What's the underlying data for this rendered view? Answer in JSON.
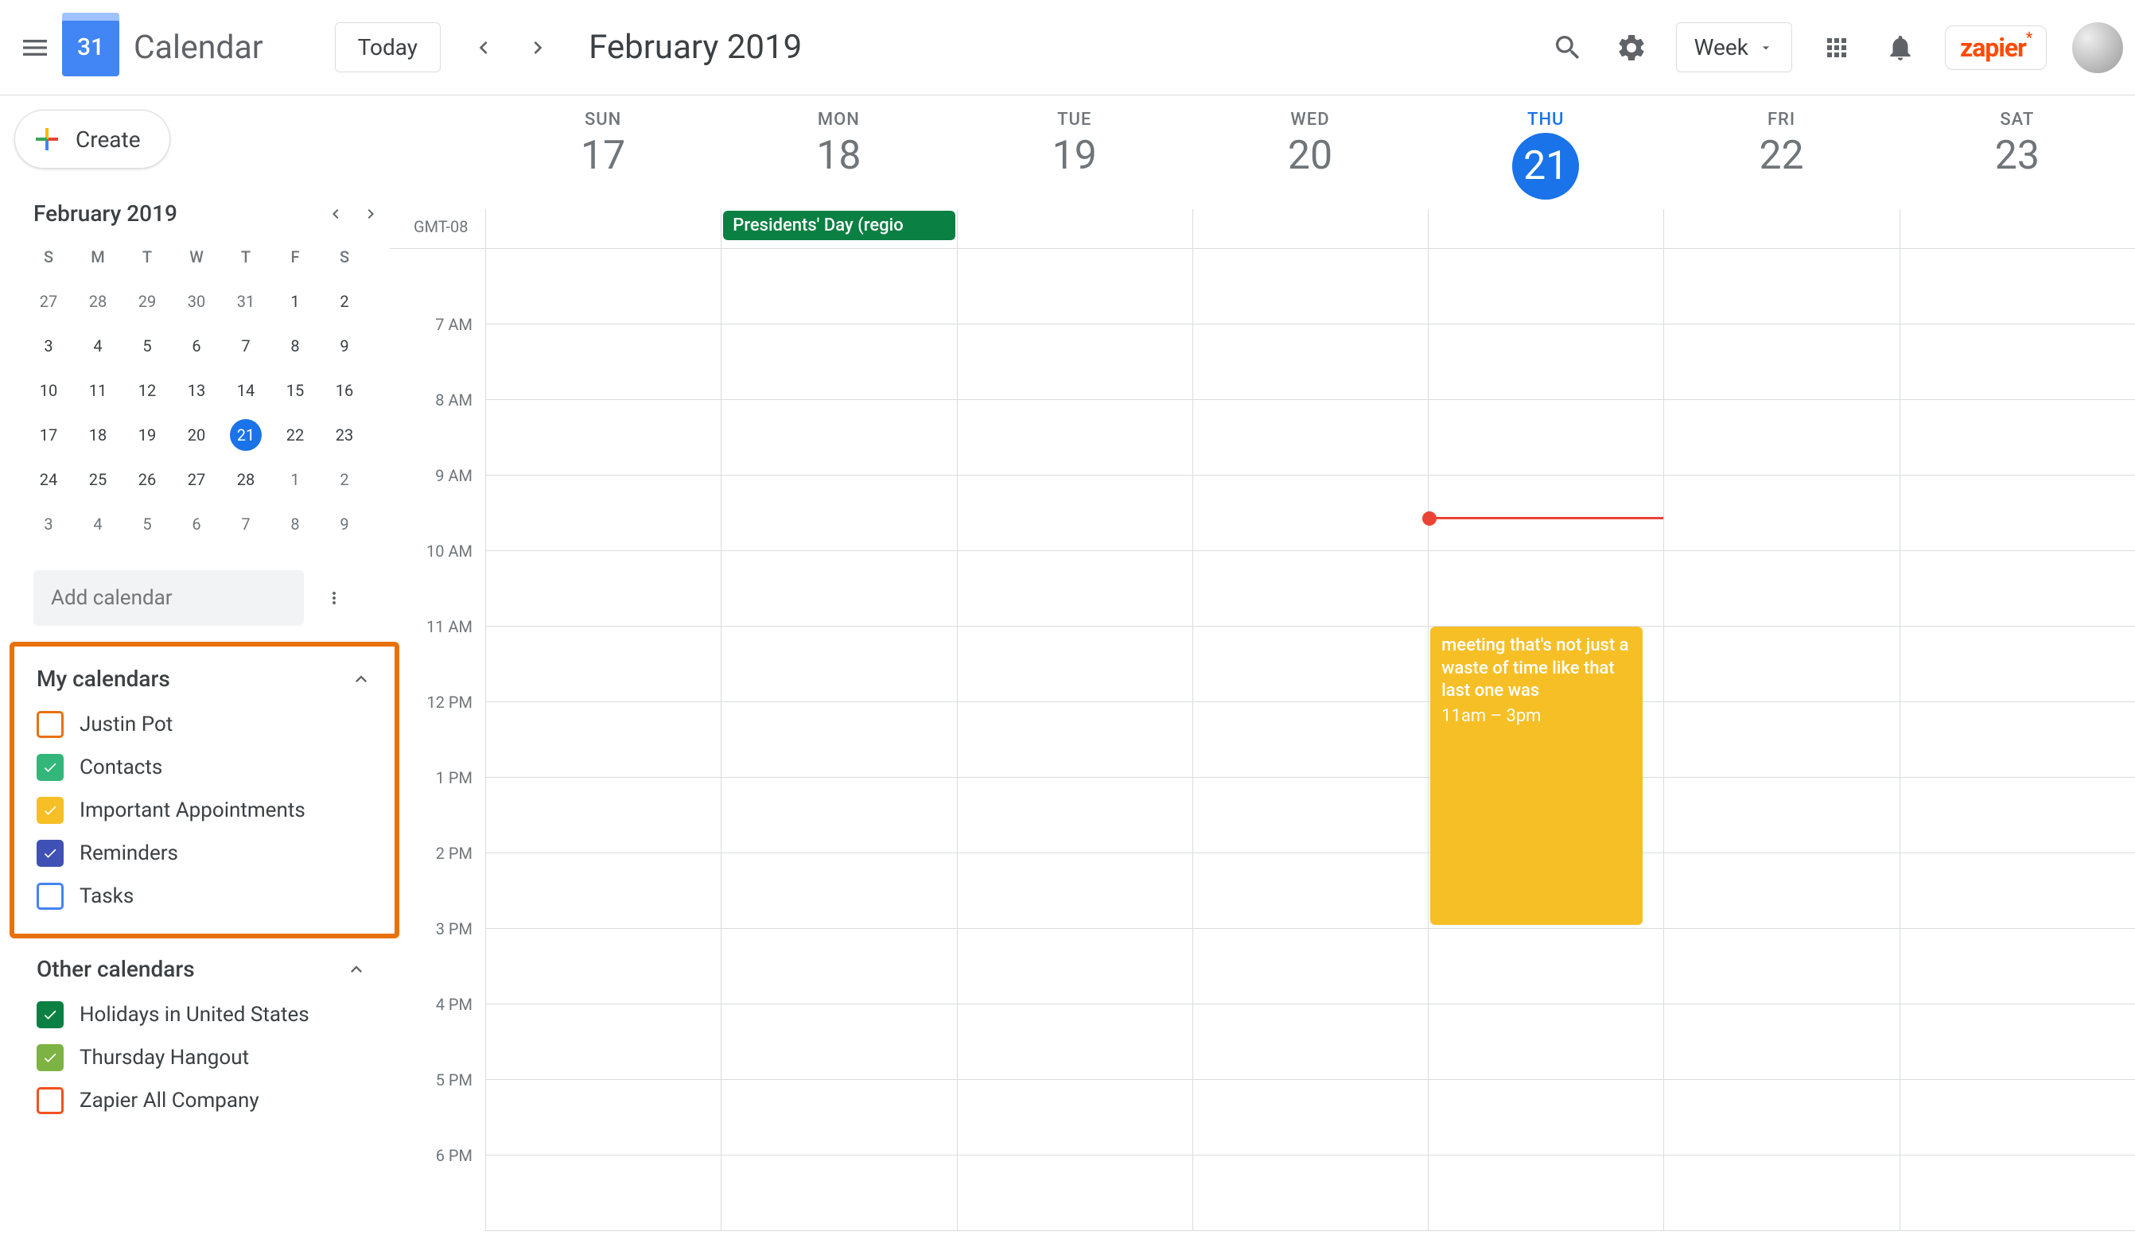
{
  "header": {
    "app_title": "Calendar",
    "logo_day": "31",
    "today_label": "Today",
    "month_title": "February 2019",
    "view_label": "Week"
  },
  "zapier": "zapier",
  "create_label": "Create",
  "mini": {
    "title": "February 2019",
    "dow": [
      "S",
      "M",
      "T",
      "W",
      "T",
      "F",
      "S"
    ],
    "rows": [
      [
        {
          "d": "27",
          "o": true
        },
        {
          "d": "28",
          "o": true
        },
        {
          "d": "29",
          "o": true
        },
        {
          "d": "30",
          "o": true
        },
        {
          "d": "31",
          "o": true
        },
        {
          "d": "1"
        },
        {
          "d": "2"
        }
      ],
      [
        {
          "d": "3"
        },
        {
          "d": "4"
        },
        {
          "d": "5"
        },
        {
          "d": "6"
        },
        {
          "d": "7"
        },
        {
          "d": "8"
        },
        {
          "d": "9"
        }
      ],
      [
        {
          "d": "10"
        },
        {
          "d": "11"
        },
        {
          "d": "12"
        },
        {
          "d": "13"
        },
        {
          "d": "14"
        },
        {
          "d": "15"
        },
        {
          "d": "16"
        }
      ],
      [
        {
          "d": "17"
        },
        {
          "d": "18"
        },
        {
          "d": "19"
        },
        {
          "d": "20"
        },
        {
          "d": "21",
          "t": true
        },
        {
          "d": "22"
        },
        {
          "d": "23"
        }
      ],
      [
        {
          "d": "24"
        },
        {
          "d": "25"
        },
        {
          "d": "26"
        },
        {
          "d": "27"
        },
        {
          "d": "28"
        },
        {
          "d": "1",
          "o": true
        },
        {
          "d": "2",
          "o": true
        }
      ],
      [
        {
          "d": "3",
          "o": true
        },
        {
          "d": "4",
          "o": true
        },
        {
          "d": "5",
          "o": true
        },
        {
          "d": "6",
          "o": true
        },
        {
          "d": "7",
          "o": true
        },
        {
          "d": "8",
          "o": true
        },
        {
          "d": "9",
          "o": true
        }
      ]
    ]
  },
  "add_calendar_placeholder": "Add calendar",
  "sections": {
    "my": {
      "title": "My calendars",
      "items": [
        {
          "label": "Justin Pot",
          "color": "#e8710a",
          "checked": false
        },
        {
          "label": "Contacts",
          "color": "#33b679",
          "checked": true
        },
        {
          "label": "Important Appointments",
          "color": "#f6bf26",
          "checked": true
        },
        {
          "label": "Reminders",
          "color": "#3f51b5",
          "checked": true
        },
        {
          "label": "Tasks",
          "color": "#4285f4",
          "checked": false
        }
      ]
    },
    "other": {
      "title": "Other calendars",
      "items": [
        {
          "label": "Holidays in United States",
          "color": "#0b8043",
          "checked": true
        },
        {
          "label": "Thursday Hangout",
          "color": "#7cb342",
          "checked": true
        },
        {
          "label": "Zapier All Company",
          "color": "#f4511e",
          "checked": false
        }
      ]
    }
  },
  "timezone": "GMT-08",
  "days": [
    {
      "dow": "SUN",
      "num": "17"
    },
    {
      "dow": "MON",
      "num": "18"
    },
    {
      "dow": "TUE",
      "num": "19"
    },
    {
      "dow": "WED",
      "num": "20"
    },
    {
      "dow": "THU",
      "num": "21",
      "today": true
    },
    {
      "dow": "FRI",
      "num": "22"
    },
    {
      "dow": "SAT",
      "num": "23"
    }
  ],
  "allday_event": {
    "day": 1,
    "label": "Presidents' Day (regio",
    "color": "#0b8043"
  },
  "hours": [
    "",
    "7 AM",
    "8 AM",
    "9 AM",
    "10 AM",
    "11 AM",
    "12 PM",
    "1 PM",
    "2 PM",
    "3 PM",
    "4 PM",
    "5 PM",
    "6 PM"
  ],
  "event": {
    "day": 4,
    "title": "meeting that's not just a waste of time like that last one was",
    "time": "11am – 3pm",
    "start_hour_index": 5,
    "duration_hours": 4,
    "color": "#f6bf26"
  },
  "now": {
    "day": 4,
    "hour_offset": 3.55
  }
}
